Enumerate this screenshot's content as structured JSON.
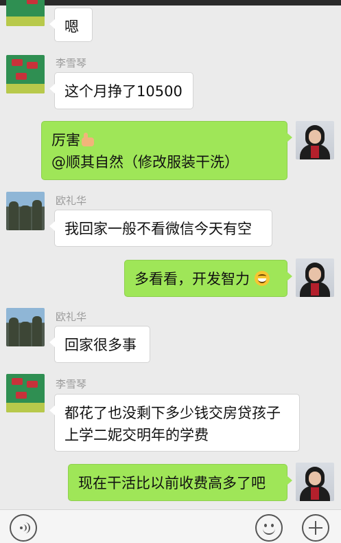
{
  "messages": [
    {
      "sender": "",
      "text": "嗯"
    },
    {
      "sender": "李雪琴",
      "text": "这个月挣了10500"
    },
    {
      "sender": "",
      "text_before": "厉害",
      "emoji": "thumbs-up-icon",
      "text_after": "@顺其自然（修改服装干洗）"
    },
    {
      "sender": "欧礼华",
      "text": "我回家一般不看微信今天有空"
    },
    {
      "sender": "",
      "text": "多看看，开发智力",
      "emoji": "grinning-face-icon"
    },
    {
      "sender": "欧礼华",
      "text": "回家很多事"
    },
    {
      "sender": "李雪琴",
      "text": "都花了也没剩下多少钱交房贷孩子上学二妮交明年的学费"
    },
    {
      "sender": "",
      "text": "现在干活比以前收费高多了吧"
    }
  ],
  "input_bar": {
    "voice_icon": "voice-icon",
    "emoji_icon": "emoji-icon",
    "more_icon": "plus-icon"
  },
  "colors": {
    "background": "#ebebeb",
    "outgoing_bubble": "#9fe658",
    "incoming_bubble": "#ffffff",
    "sender_name": "#9a9a9a"
  }
}
